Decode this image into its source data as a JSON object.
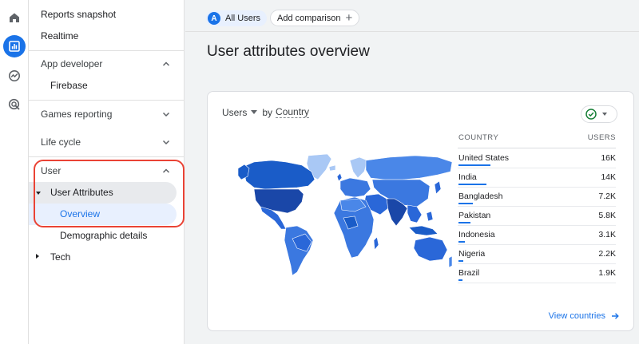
{
  "sidebar": {
    "reports_snapshot": "Reports snapshot",
    "realtime": "Realtime",
    "app_developer": "App developer",
    "firebase": "Firebase",
    "games_reporting": "Games reporting",
    "life_cycle": "Life cycle",
    "user": "User",
    "user_attributes": "User Attributes",
    "overview": "Overview",
    "demographic_details": "Demographic details",
    "tech": "Tech"
  },
  "rail": {
    "icons": [
      "home-icon",
      "reports-icon",
      "explore-icon",
      "advertising-icon"
    ],
    "accent": "#1a73e8"
  },
  "topbar": {
    "audience_badge": "A",
    "audience_label": "All Users",
    "add_comparison": "Add comparison",
    "plus": "+"
  },
  "page": {
    "title": "User attributes overview"
  },
  "card": {
    "metric": "Users",
    "by": "by",
    "dimension": "Country",
    "col_country": "COUNTRY",
    "col_users": "USERS",
    "rows": [
      {
        "country": "United States",
        "users": "16K",
        "share": 1.0
      },
      {
        "country": "India",
        "users": "14K",
        "share": 0.875
      },
      {
        "country": "Bangladesh",
        "users": "7.2K",
        "share": 0.45
      },
      {
        "country": "Pakistan",
        "users": "5.8K",
        "share": 0.3625
      },
      {
        "country": "Indonesia",
        "users": "3.1K",
        "share": 0.19
      },
      {
        "country": "Nigeria",
        "users": "2.2K",
        "share": 0.14
      },
      {
        "country": "Brazil",
        "users": "1.9K",
        "share": 0.12
      }
    ],
    "view_link": "View countries"
  },
  "colors": {
    "highlight": "#ea4335",
    "map_dark": "#1a47a8",
    "map_mid": "#3b78e0",
    "map_light": "#a9c8f5"
  }
}
